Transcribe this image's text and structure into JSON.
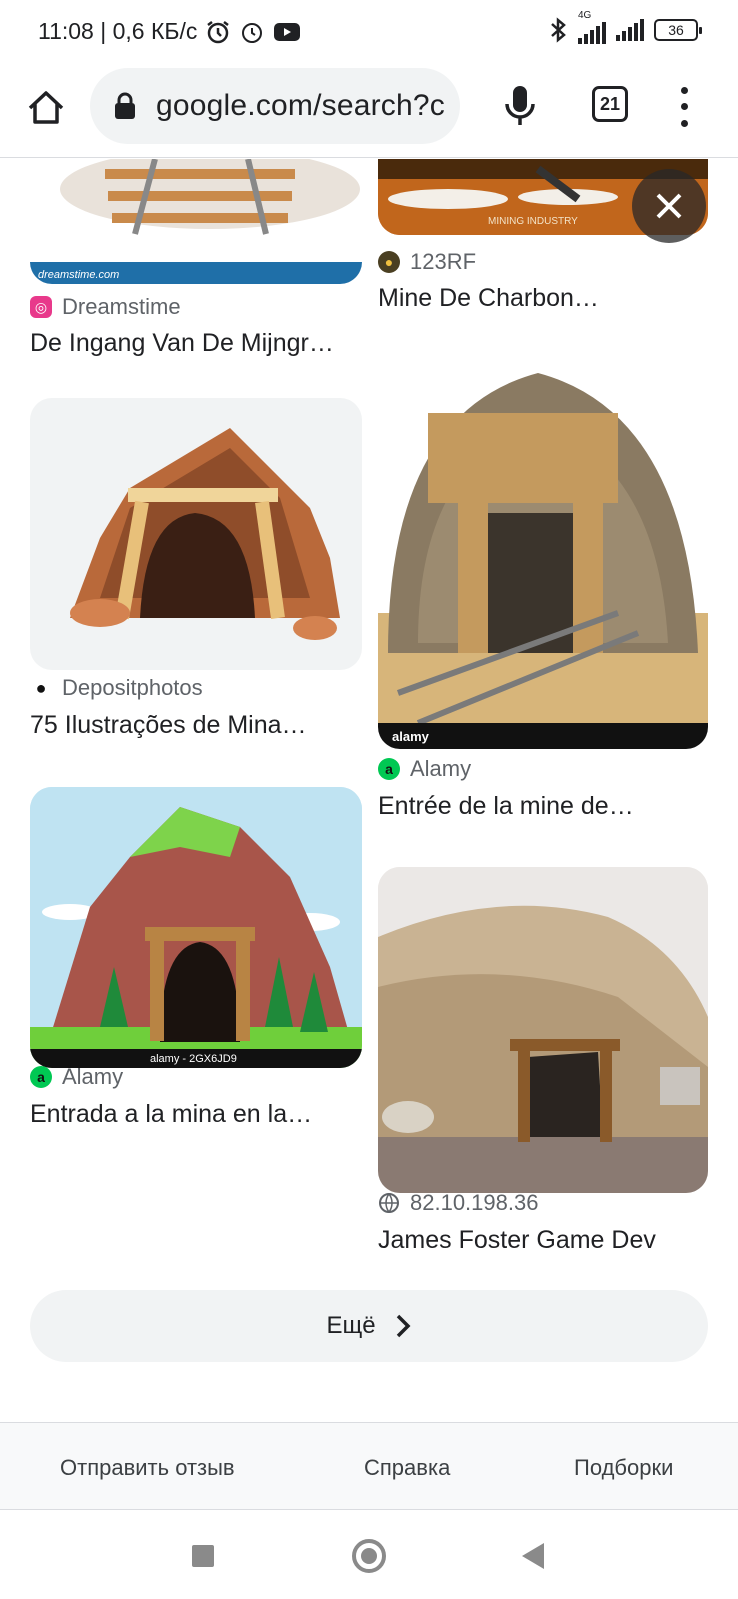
{
  "status_bar": {
    "time_and_speed": "11:08 | 0,6 КБ/с",
    "network": "4G",
    "battery": "36"
  },
  "browser": {
    "url": "google.com/search?c",
    "tab_count": "21"
  },
  "results": [
    {
      "source": "Dreamstime",
      "title": "De Ingang Van De Mijngr…",
      "icon": "dreamstime-icon",
      "color": "#e8398b",
      "watermark": "dreamstime.com"
    },
    {
      "source": "123RF",
      "title": "Mine De Charbon…",
      "icon": "123rf-icon",
      "color": "#4a3f22",
      "watermark": "MINING INDUSTRY"
    },
    {
      "source": "Depositphotos",
      "title": "75 Ilustrações de Mina…",
      "icon": "depositphotos-icon",
      "color": "#111111"
    },
    {
      "source": "Alamy",
      "title": "Entrée de la mine de…",
      "icon": "alamy-icon",
      "color": "#00c853",
      "icon_letter": "a",
      "watermark": "alamy"
    },
    {
      "source": "Alamy",
      "title": "Entrada a la mina en la…",
      "icon": "alamy-icon",
      "color": "#00c853",
      "icon_letter": "a",
      "watermark": "alamy - 2GX6JD9"
    },
    {
      "source": "82.10.198.36",
      "title": "James Foster Game Dev",
      "icon": "globe-icon",
      "color": "#5f6368"
    }
  ],
  "more_button": {
    "label": "Ещё"
  },
  "footer": {
    "feedback": "Отправить отзыв",
    "help": "Справка",
    "collections": "Подборки"
  }
}
